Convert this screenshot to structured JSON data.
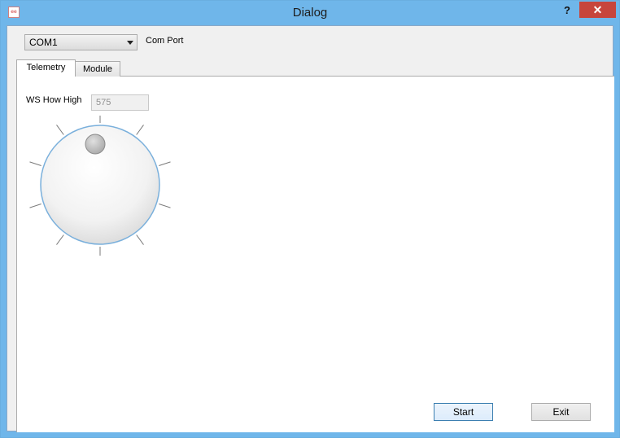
{
  "window": {
    "title": "Dialog",
    "app_icon_text": "ee",
    "help_label": "?",
    "close_label": "✕"
  },
  "com_port": {
    "selected": "COM1",
    "label": "Com Port"
  },
  "tabs": [
    {
      "label": "Telemetry",
      "active": true
    },
    {
      "label": "Module",
      "active": false
    }
  ],
  "telemetry": {
    "field_label": "WS How High",
    "field_value": "575",
    "dial": {
      "knob": "rotary-dial",
      "tick_count": 11
    }
  },
  "buttons": {
    "start": "Start",
    "exit": "Exit"
  },
  "colors": {
    "titlebar": "#6fb6ea",
    "close": "#c7453c",
    "default_button_border": "#3c7fb1"
  }
}
